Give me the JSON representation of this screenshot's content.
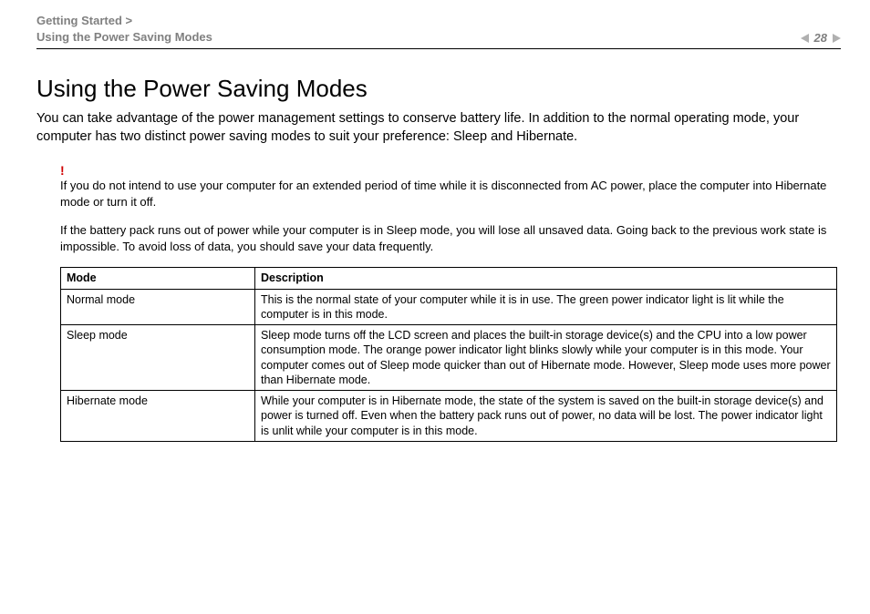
{
  "header": {
    "breadcrumb_line1": "Getting Started >",
    "breadcrumb_line2": "Using the Power Saving Modes",
    "page_number": "28"
  },
  "title": "Using the Power Saving Modes",
  "intro": "You can take advantage of the power management settings to conserve battery life. In addition to the normal operating mode, your computer has two distinct power saving modes to suit your preference: Sleep and Hibernate.",
  "warning_mark": "!",
  "warning_p1": "If you do not intend to use your computer for an extended period of time while it is disconnected from AC power, place the computer into Hibernate mode or turn it off.",
  "warning_p2": "If the battery pack runs out of power while your computer is in Sleep mode, you will lose all unsaved data. Going back to the previous work state is impossible. To avoid loss of data, you should save your data frequently.",
  "table": {
    "headers": {
      "mode": "Mode",
      "description": "Description"
    },
    "rows": [
      {
        "mode": "Normal mode",
        "description": "This is the normal state of your computer while it is in use. The green power indicator light is lit while the computer is in this mode."
      },
      {
        "mode": "Sleep mode",
        "description": "Sleep mode turns off the LCD screen and places the built-in storage device(s) and the CPU into a low power consumption mode. The orange power indicator light blinks slowly while your computer is in this mode. Your computer comes out of Sleep mode quicker than out of Hibernate mode. However, Sleep mode uses more power than Hibernate mode."
      },
      {
        "mode": "Hibernate mode",
        "description": "While your computer is in Hibernate mode, the state of the system is saved on the built-in storage device(s) and power is turned off. Even when the battery pack runs out of power, no data will be lost. The power indicator light is unlit while your computer is in this mode."
      }
    ]
  }
}
